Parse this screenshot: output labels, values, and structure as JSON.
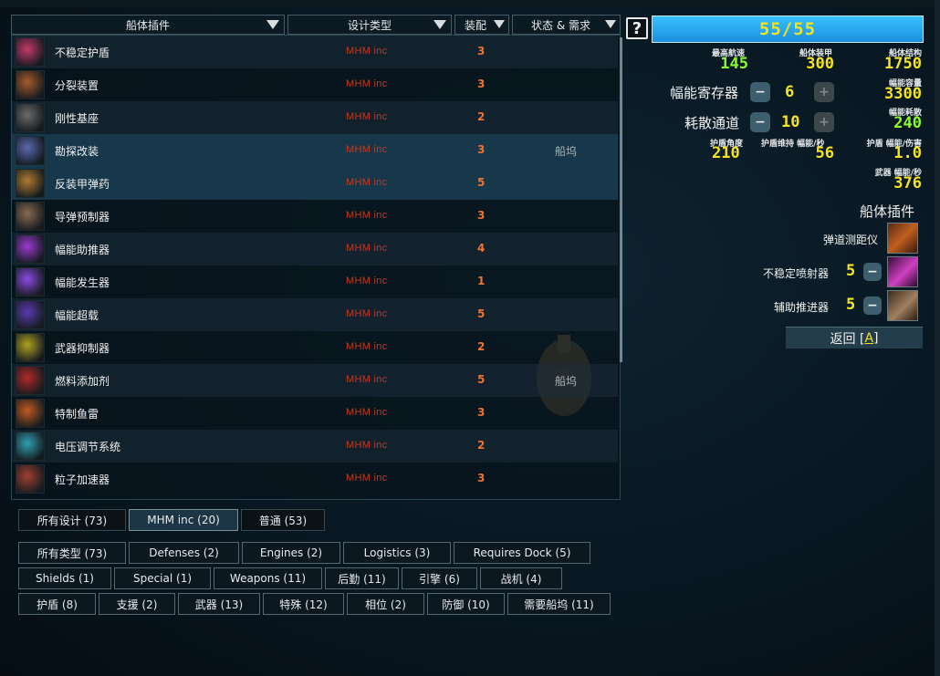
{
  "columns": {
    "hullmod": "船体插件",
    "design_type": "设计类型",
    "ordnance": "装配",
    "status": "状态 & 需求"
  },
  "rows": [
    {
      "name": "不稳定护盾",
      "maker": "MHM inc",
      "op": "3",
      "status": "",
      "icon": "unstable-shield-icon",
      "color": "#c23a6a"
    },
    {
      "name": "分裂装置",
      "maker": "MHM inc",
      "op": "3",
      "status": "",
      "icon": "splitter-icon",
      "color": "#a85a2a"
    },
    {
      "name": "刚性基座",
      "maker": "MHM inc",
      "op": "2",
      "status": "",
      "icon": "rigid-mount-icon",
      "color": "#6a6a6a"
    },
    {
      "name": "勘探改装",
      "maker": "MHM inc",
      "op": "3",
      "status": "船坞",
      "icon": "survey-refit-icon",
      "color": "#5a6ab0"
    },
    {
      "name": "反装甲弹药",
      "maker": "MHM inc",
      "op": "5",
      "status": "",
      "icon": "anti-armor-ammo-icon",
      "color": "#b07a30"
    },
    {
      "name": "导弹预制器",
      "maker": "MHM inc",
      "op": "3",
      "status": "",
      "icon": "missile-fabricator-icon",
      "color": "#8a6a50"
    },
    {
      "name": "幅能助推器",
      "maker": "MHM inc",
      "op": "4",
      "status": "",
      "icon": "flux-booster-icon",
      "color": "#9a3ad0"
    },
    {
      "name": "幅能发生器",
      "maker": "MHM inc",
      "op": "1",
      "status": "",
      "icon": "flux-generator-icon",
      "color": "#8a4ae0"
    },
    {
      "name": "幅能超载",
      "maker": "MHM inc",
      "op": "5",
      "status": "",
      "icon": "flux-overload-icon",
      "color": "#5a3ab0"
    },
    {
      "name": "武器抑制器",
      "maker": "MHM inc",
      "op": "2",
      "status": "",
      "icon": "weapon-suppressor-icon",
      "color": "#b0a020"
    },
    {
      "name": "燃料添加剂",
      "maker": "MHM inc",
      "op": "5",
      "status": "船坞",
      "icon": "fuel-additive-icon",
      "color": "#b02a2a"
    },
    {
      "name": "特制鱼雷",
      "maker": "MHM inc",
      "op": "3",
      "status": "",
      "icon": "special-torpedo-icon",
      "color": "#c05a20"
    },
    {
      "name": "电压调节系统",
      "maker": "MHM inc",
      "op": "2",
      "status": "",
      "icon": "voltage-regulator-icon",
      "color": "#30a0b0"
    },
    {
      "name": "粒子加速器",
      "maker": "MHM inc",
      "op": "3",
      "status": "",
      "icon": "particle-accelerator-icon",
      "color": "#a04030"
    }
  ],
  "design_tabs": [
    "所有设计 (73)",
    "MHM inc (20)",
    "普通 (53)"
  ],
  "type_tabs_row1": [
    "所有类型 (73)",
    "Defenses (2)",
    "Engines (2)",
    "Logistics (3)",
    "Requires Dock (5)"
  ],
  "type_tabs_row2": [
    "Shields (1)",
    "Special (1)",
    "Weapons (11)",
    "后勤 (11)",
    "引擎 (6)",
    "战机 (4)"
  ],
  "type_tabs_row3": [
    "护盾 (8)",
    "支援 (2)",
    "武器 (13)",
    "特殊 (12)",
    "相位 (2)",
    "防御 (10)",
    "需要船坞 (11)"
  ],
  "help_label": "?",
  "ordnance_points": "55/55",
  "stats": {
    "max_speed_label": "最高航速",
    "max_speed": "145",
    "armor_label": "船体装甲",
    "armor": "300",
    "hull_label": "船体结构",
    "hull": "1750",
    "flux_cap_label": "幅能容量",
    "flux_cap": "3300",
    "flux_diss_label": "幅能耗散",
    "flux_diss": "240",
    "shield_arc_label": "护盾角度",
    "shield_arc": "210",
    "shield_upkeep_label": "护盾维持 幅能/秒",
    "shield_upkeep": "56",
    "shield_eff_label": "护盾 幅能/伤害",
    "shield_eff": "1.0",
    "weapon_flux_label": "武器 幅能/秒",
    "weapon_flux": "376"
  },
  "capacitors": {
    "label": "幅能寄存器",
    "value": "6",
    "minus": "−",
    "plus": "+"
  },
  "vents": {
    "label": "耗散通道",
    "value": "10",
    "minus": "−",
    "plus": "+"
  },
  "hullmods_title": "船体插件",
  "installed": [
    {
      "name": "弹道测距仪",
      "cost": "",
      "icon": "ballistic-rangefinder-icon",
      "removable": false
    },
    {
      "name": "不稳定喷射器",
      "cost": "5",
      "icon": "unstable-injector-icon",
      "removable": true
    },
    {
      "name": "辅助推进器",
      "cost": "5",
      "icon": "auxiliary-thrusters-icon",
      "removable": true
    }
  ],
  "back_button": {
    "label": "返回 [",
    "hotkey": "A",
    "suffix": "]"
  }
}
